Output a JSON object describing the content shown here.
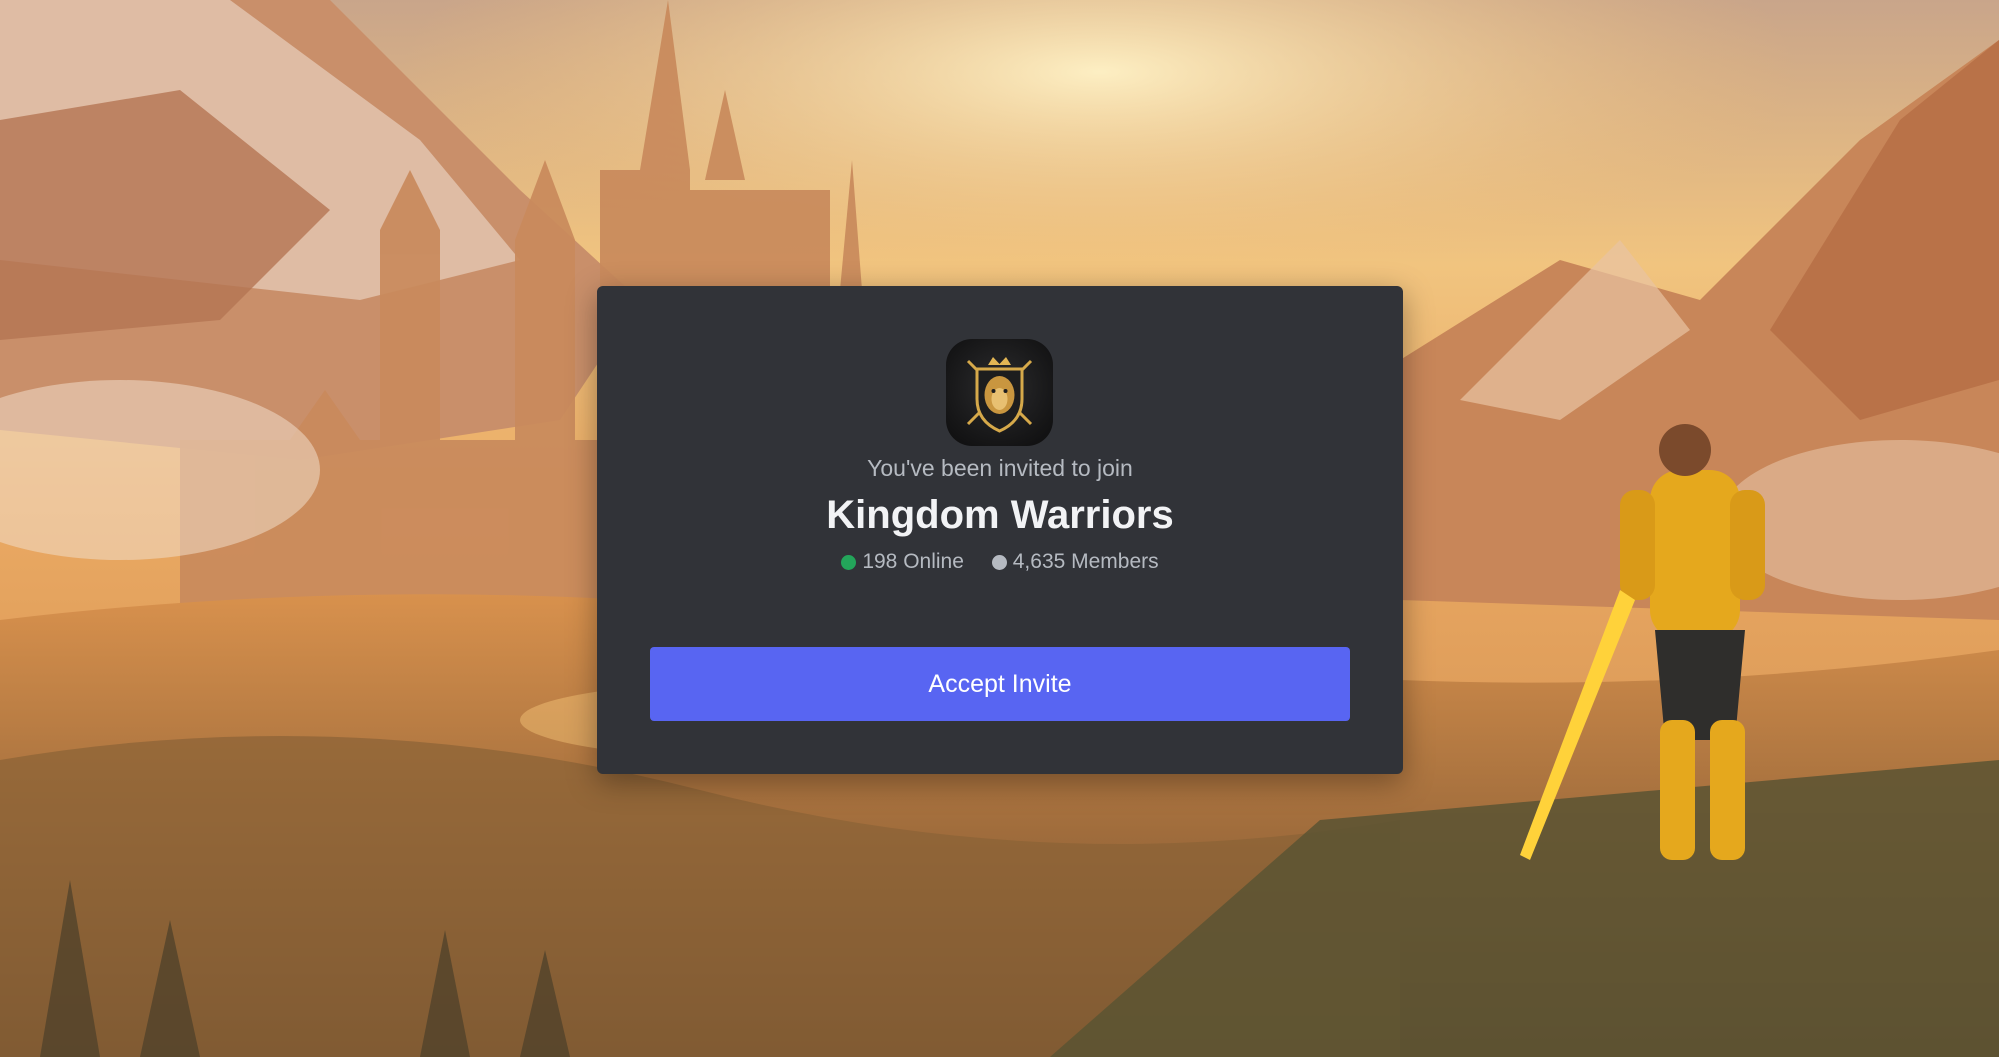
{
  "invite": {
    "invited_text": "You've been invited to join",
    "server_name": "Kingdom Warriors",
    "online_count": "198 Online",
    "member_count": "4,635 Members",
    "server_icon": "lion-crest-icon",
    "accept_label": "Accept Invite"
  },
  "colors": {
    "card_background": "#313338",
    "button": "#5865f2",
    "online_dot": "#23a55a",
    "members_dot": "#b5bac1",
    "title_text": "#f2f3f5",
    "muted_text": "#b5bac1"
  }
}
